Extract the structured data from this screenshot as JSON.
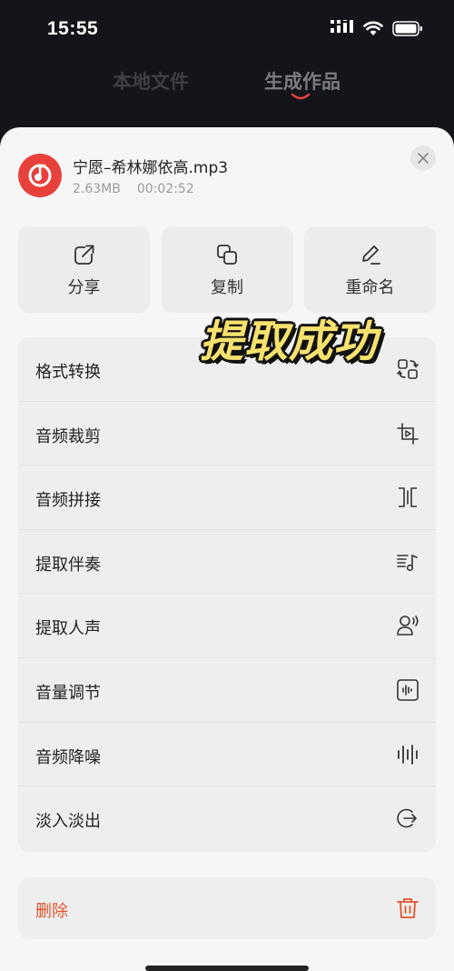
{
  "status": {
    "time": "15:55"
  },
  "tabs": {
    "local": "本地文件",
    "generated": "生成作品"
  },
  "file": {
    "name": "宁愿–希林娜依高.mp3",
    "size": "2.63MB",
    "duration": "00:02:52"
  },
  "actions": [
    {
      "label": "分享",
      "icon": "share-icon"
    },
    {
      "label": "复制",
      "icon": "copy-icon"
    },
    {
      "label": "重命名",
      "icon": "rename-icon"
    }
  ],
  "menu": [
    {
      "label": "格式转换",
      "icon": "format-convert-icon"
    },
    {
      "label": "音频裁剪",
      "icon": "crop-icon"
    },
    {
      "label": "音频拼接",
      "icon": "splice-icon"
    },
    {
      "label": "提取伴奏",
      "icon": "accompaniment-icon"
    },
    {
      "label": "提取人声",
      "icon": "voice-icon"
    },
    {
      "label": "音量调节",
      "icon": "volume-icon"
    },
    {
      "label": "音频降噪",
      "icon": "denoise-icon"
    },
    {
      "label": "淡入淡出",
      "icon": "fade-icon"
    }
  ],
  "delete": {
    "label": "删除",
    "icon": "trash-icon",
    "color": "#e2542c"
  },
  "overlay": {
    "text": "提取成功"
  },
  "colors": {
    "accent": "#e8413c",
    "background": "#14141b",
    "sheet": "#f6f6f6"
  }
}
